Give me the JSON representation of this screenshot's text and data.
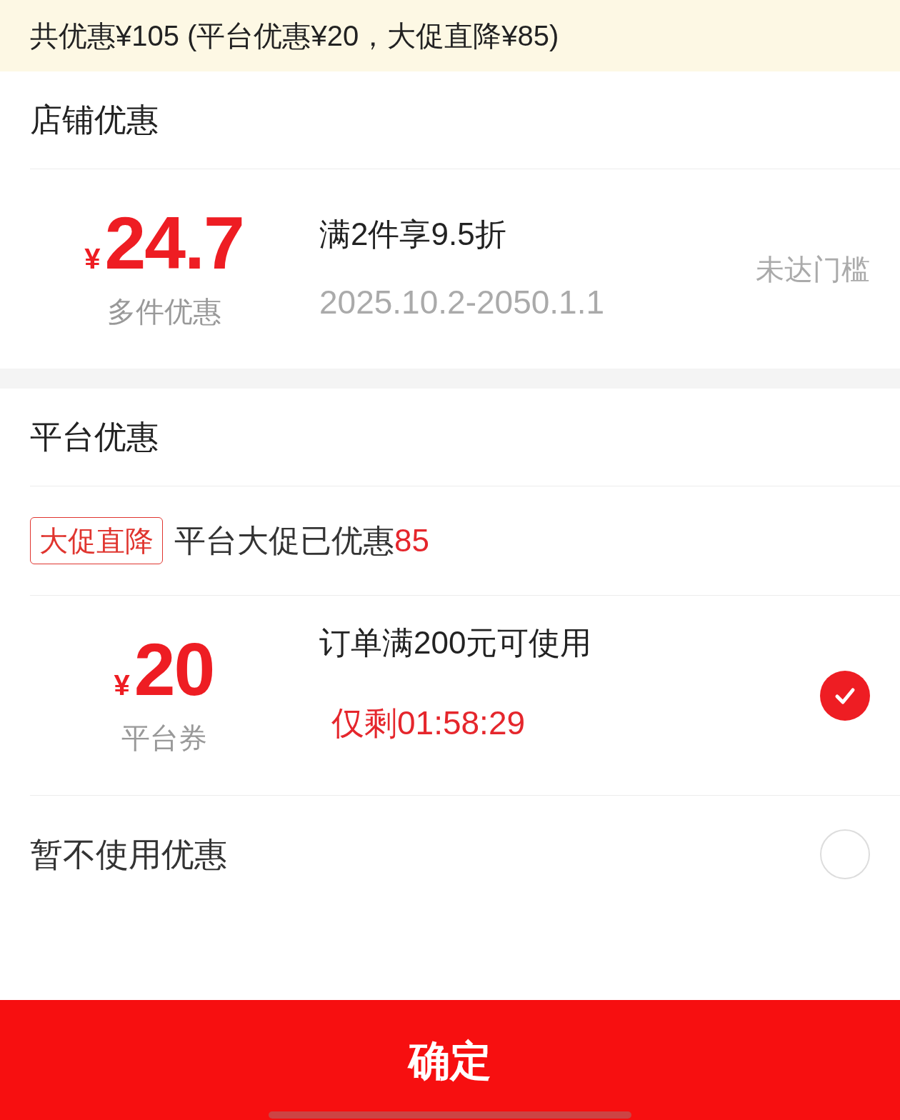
{
  "summary": "共优惠¥105 (平台优惠¥20，大促直降¥85)",
  "sections": [
    {
      "title": "店铺优惠",
      "items": [
        {
          "kind": "coupon",
          "currency": "¥",
          "amount": "24.7",
          "type_label": "多件优惠",
          "condition": "满2件享9.5折",
          "subtitle": "2025.10.2-2050.1.1",
          "subtitle_alert": false,
          "status": "未达门槛"
        }
      ]
    },
    {
      "title": "平台优惠",
      "items": [
        {
          "kind": "promo",
          "tag": "大促直降",
          "text": "平台大促已优惠",
          "amount": "85"
        },
        {
          "kind": "coupon",
          "currency": "¥",
          "amount": "20",
          "type_label": "平台券",
          "condition": "订单满200元可使用",
          "subtitle": "仅剩01:58:29",
          "subtitle_alert": true,
          "selected": true
        },
        {
          "kind": "none",
          "label": "暂不使用优惠",
          "selected": false
        }
      ]
    }
  ],
  "confirm_button": "确定"
}
